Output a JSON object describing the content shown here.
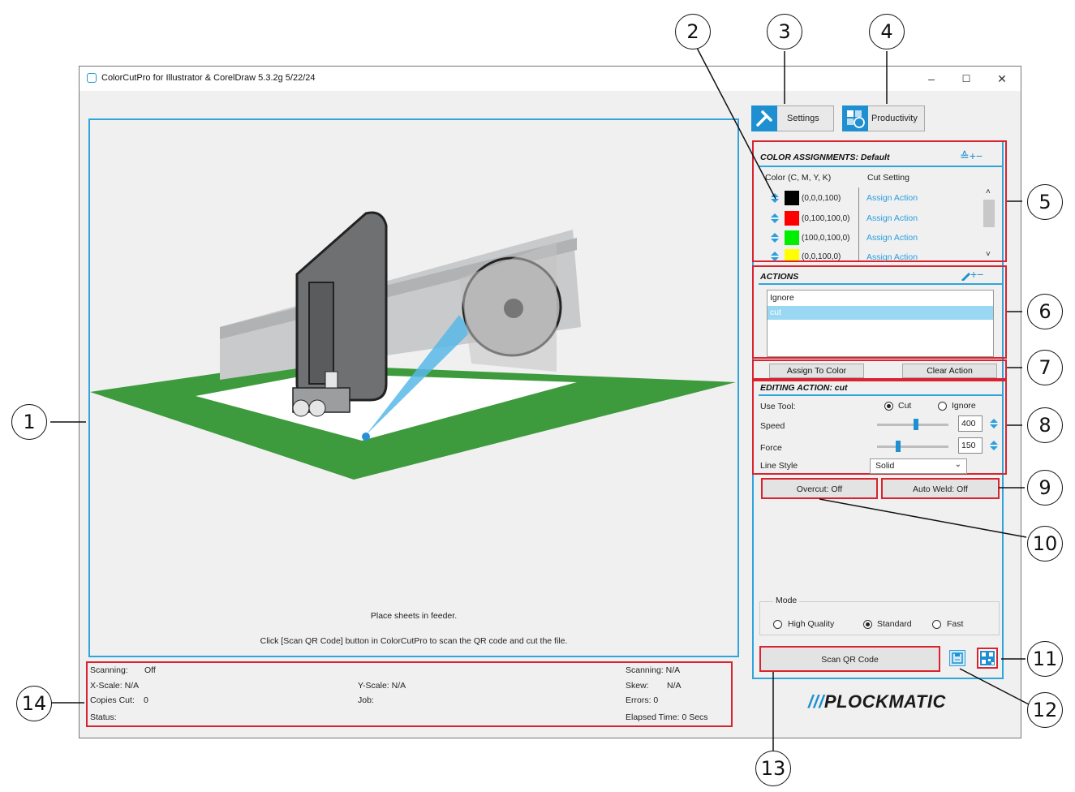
{
  "window": {
    "title": "ColorCutPro for Illustrator & CorelDraw 5.3.2g 5/22/24",
    "minimize": "–",
    "maximize": "☐",
    "close": "✕"
  },
  "toolbar": {
    "settings_label": "Settings",
    "productivity_label": "Productivity"
  },
  "color_assignments": {
    "title": "COLOR ASSIGNMENTS: Default",
    "header_controls": "≙+−",
    "col_color": "Color (C, M, Y, K)",
    "col_cut": "Cut Setting",
    "rows": [
      {
        "color": "#000000",
        "cmyk": "(0,0,0,100)",
        "action": "Assign Action"
      },
      {
        "color": "#ff0000",
        "cmyk": "(0,100,100,0)",
        "action": "Assign Action"
      },
      {
        "color": "#00ee00",
        "cmyk": "(100,0,100,0)",
        "action": "Assign Action"
      },
      {
        "color": "#ffff00",
        "cmyk": "(0,0,100,0)",
        "action": "Assign Action"
      }
    ]
  },
  "actions": {
    "title": "ACTIONS",
    "header_controls": "+−",
    "items": [
      "Ignore",
      "cut"
    ],
    "selected": "cut",
    "assign_button": "Assign To Color",
    "clear_button": "Clear Action"
  },
  "editing": {
    "title": "EDITING ACTION: cut",
    "use_tool_label": "Use Tool:",
    "tool_cut": "Cut",
    "tool_ignore": "Ignore",
    "speed_label": "Speed",
    "speed_value": "400",
    "speed_level": 0.55,
    "force_label": "Force",
    "force_value": "150",
    "force_level": 0.3,
    "line_style_label": "Line Style",
    "line_style_value": "Solid"
  },
  "overcut_button": "Overcut: Off",
  "autoweld_button": "Auto Weld: Off",
  "mode": {
    "label": "Mode",
    "options": [
      "High Quality",
      "Standard",
      "Fast"
    ],
    "selected": "Standard"
  },
  "scan_button": "Scan QR Code",
  "brand": "PLOCKMATIC",
  "brand_slashes": "///",
  "canvas": {
    "msg1": "Place sheets in feeder.",
    "msg2": "Click [Scan QR Code] button in ColorCutPro to scan the QR code and cut the file."
  },
  "status": {
    "scanning_left_label": "Scanning:",
    "scanning_left_value": "Off",
    "xscale": "X-Scale: N/A",
    "copies_label": "Copies Cut:",
    "copies_value": "0",
    "status_label": "Status:",
    "yscale": "Y-Scale: N/A",
    "job": "Job:",
    "scanning_right": "Scanning: N/A",
    "skew_label": "Skew:",
    "skew_value": "N/A",
    "errors": "Errors:  0",
    "elapsed": "Elapsed Time:  0 Secs"
  },
  "callouts": [
    "1",
    "2",
    "3",
    "4",
    "5",
    "6",
    "7",
    "8",
    "9",
    "10",
    "11",
    "12",
    "13",
    "14"
  ]
}
